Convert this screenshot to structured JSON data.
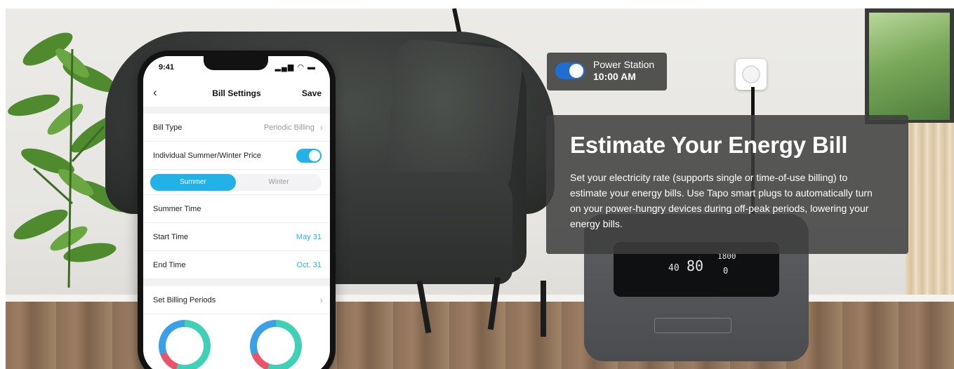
{
  "overlay": {
    "device_card": {
      "name": "Power Station",
      "time": "10:00 AM"
    },
    "headline": "Estimate Your Energy Bill",
    "description": "Set your electricity rate (supports single or time-of-use billing) to estimate your energy bills. Use Tapo smart plugs to automatically turn on your power-hungry devices during off-peak periods, lowering your energy bills."
  },
  "phone": {
    "status_time": "9:41",
    "status_icons": "▂▄▆ ◠ ▬",
    "title": "Bill Settings",
    "back": "‹",
    "save": "Save",
    "bill_type_label": "Bill Type",
    "bill_type_value": "Periodic Billing",
    "individual_price_label": "Individual Summer/Winter Price",
    "segments": {
      "summer": "Summer",
      "winter": "Winter"
    },
    "summer_time_label": "Summer Time",
    "start_time_label": "Start Time",
    "start_time_value": "May 31",
    "end_time_label": "End Time",
    "end_time_value": "Oct. 31",
    "billing_periods_label": "Set Billing Periods",
    "chevron": "›"
  },
  "station": {
    "readout_main": "80",
    "readout_left": "40",
    "readout_right_top": "1800",
    "readout_right_bottom": "0"
  },
  "colors": {
    "accent": "#23b2e8",
    "device_toggle": "#1f6fd1",
    "overlay_bg": "#3e3e3e"
  }
}
